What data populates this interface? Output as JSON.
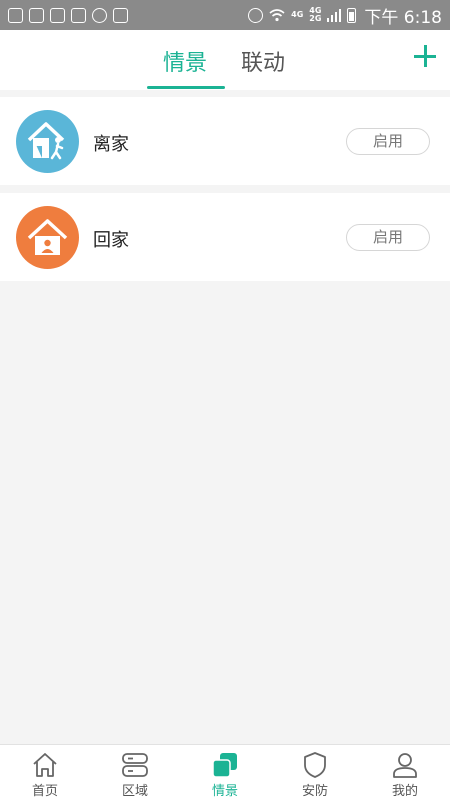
{
  "status_bar": {
    "network_primary": "4G",
    "network_secondary": "4G\n2G",
    "time": "下午 6:18"
  },
  "header": {
    "tabs": [
      {
        "label": "情景",
        "active": true
      },
      {
        "label": "联动",
        "active": false
      }
    ],
    "add_icon": "plus-icon"
  },
  "scenes": [
    {
      "name": "离家",
      "icon": "leave-home-icon",
      "color": "#5ab6d8",
      "button": "启用"
    },
    {
      "name": "回家",
      "icon": "return-home-icon",
      "color": "#ef7d3e",
      "button": "启用"
    }
  ],
  "bottom_nav": {
    "items": [
      {
        "label": "首页",
        "icon": "home-icon",
        "active": false
      },
      {
        "label": "区域",
        "icon": "area-icon",
        "active": false
      },
      {
        "label": "情景",
        "icon": "scene-icon",
        "active": true
      },
      {
        "label": "安防",
        "icon": "shield-icon",
        "active": false
      },
      {
        "label": "我的",
        "icon": "user-icon",
        "active": false
      }
    ]
  },
  "colors": {
    "accent": "#1bb394",
    "status_bar": "#8a8a8a",
    "background": "#f4f4f4"
  }
}
